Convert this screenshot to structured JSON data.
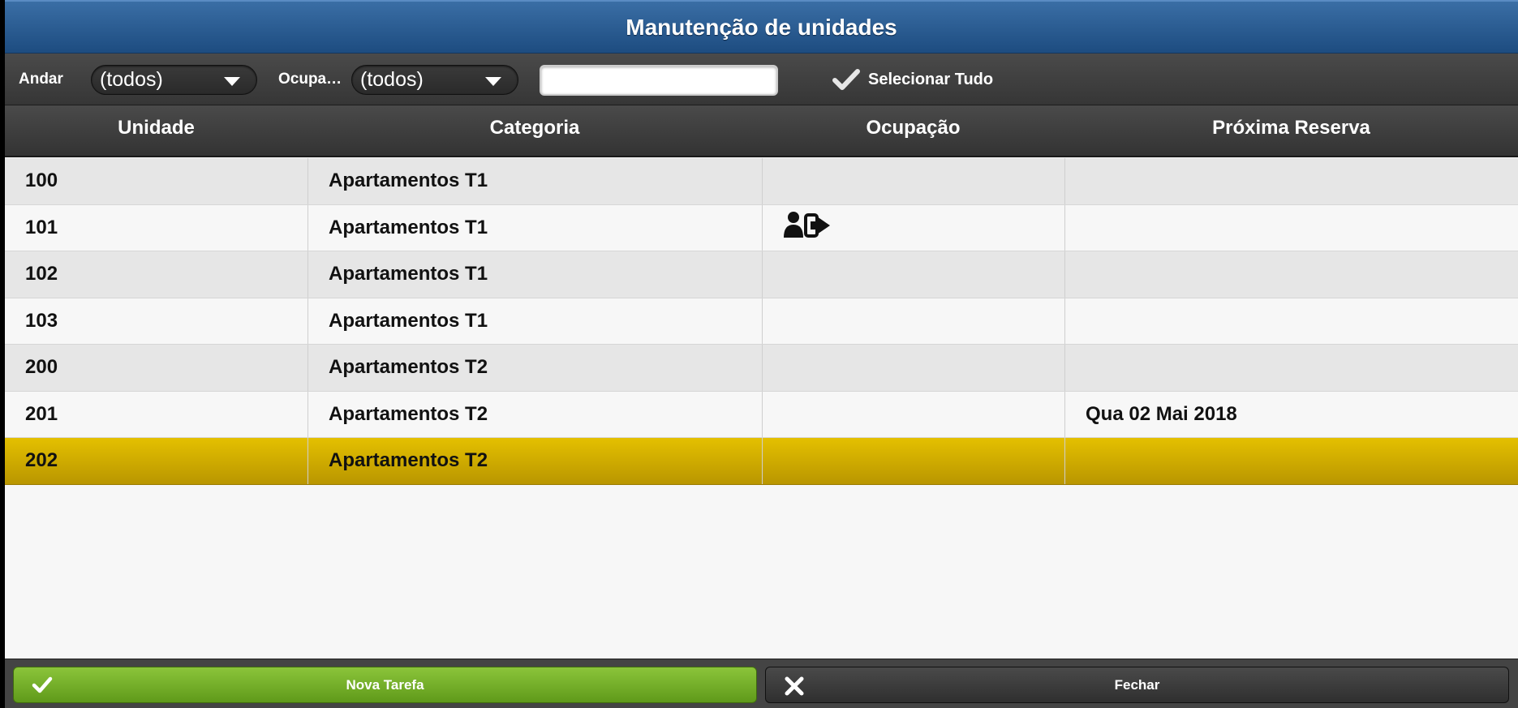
{
  "title": "Manutenção de unidades",
  "toolbar": {
    "andar_label": "Andar",
    "andar_value": "(todos)",
    "ocupacao_label": "Ocupa…",
    "ocupacao_value": "(todos)",
    "search_value": "",
    "select_all_label": "Selecionar Tudo"
  },
  "table": {
    "headers": [
      "Unidade",
      "Categoria",
      "Ocupação",
      "Próxima Reserva"
    ],
    "rows": [
      {
        "unidade": "100",
        "categoria": "Apartamentos T1",
        "ocupacao_icon": "",
        "proxima": ""
      },
      {
        "unidade": "101",
        "categoria": "Apartamentos T1",
        "ocupacao_icon": "guest-checkout-icon",
        "proxima": ""
      },
      {
        "unidade": "102",
        "categoria": "Apartamentos T1",
        "ocupacao_icon": "",
        "proxima": ""
      },
      {
        "unidade": "103",
        "categoria": "Apartamentos T1",
        "ocupacao_icon": "",
        "proxima": ""
      },
      {
        "unidade": "200",
        "categoria": "Apartamentos T2",
        "ocupacao_icon": "",
        "proxima": ""
      },
      {
        "unidade": "201",
        "categoria": "Apartamentos T2",
        "ocupacao_icon": "",
        "proxima": "Qua 02 Mai 2018"
      },
      {
        "unidade": "202",
        "categoria": "Apartamentos T2",
        "ocupacao_icon": "",
        "proxima": ""
      }
    ],
    "selected_row": "202"
  },
  "footer": {
    "new_task_label": "Nova Tarefa",
    "close_label": "Fechar"
  },
  "colors": {
    "title_bar": "#2a5d94",
    "selected_row": "#d4b000",
    "primary_button": "#6fa82a"
  }
}
